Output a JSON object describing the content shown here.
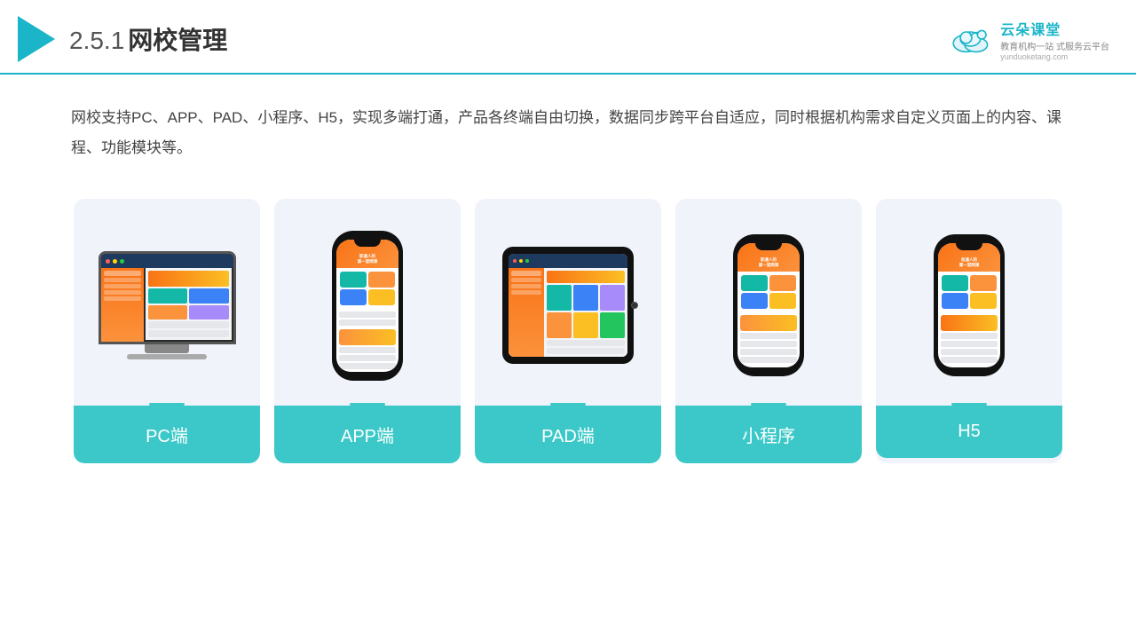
{
  "header": {
    "section_number": "2.5.1",
    "title": "网校管理",
    "brand": {
      "name": "云朵课堂",
      "name_pinyin": "yunduoketang.com",
      "slogan_line1": "教育机构一站",
      "slogan_line2": "式服务云平台"
    }
  },
  "description": {
    "text": "网校支持PC、APP、PAD、小程序、H5，实现多端打通，产品各终端自由切换，数据同步跨平台自适应，同时根据机构需求自定义页面上的内容、课程、功能模块等。"
  },
  "cards": [
    {
      "id": "pc",
      "label": "PC端"
    },
    {
      "id": "app",
      "label": "APP端"
    },
    {
      "id": "pad",
      "label": "PAD端"
    },
    {
      "id": "miniprogram",
      "label": "小程序"
    },
    {
      "id": "h5",
      "label": "H5"
    }
  ],
  "colors": {
    "teal": "#3cc8c8",
    "accent": "#1ab5c8",
    "card_bg": "#eef1f8",
    "dark": "#1a1a2e"
  }
}
